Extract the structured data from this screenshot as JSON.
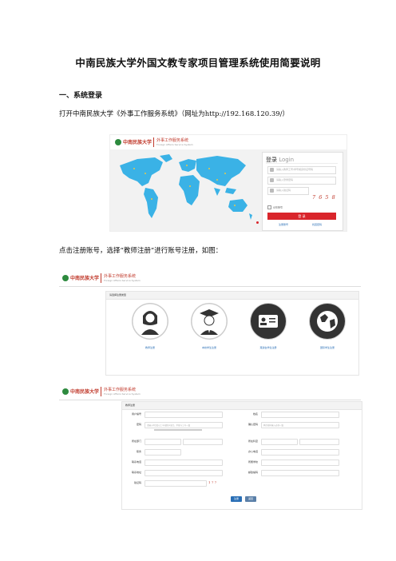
{
  "doc": {
    "title": "中南民族大学外国文教专家项目管理系统使用简要说明",
    "section1": "一、系统登录",
    "para1": "打开中南民族大学《外事工作服务系统》（网址为http://192.168.120.39/）",
    "para2": "点击注册账号，选择“教师注册”进行账号注册，如图："
  },
  "login_shot": {
    "logo_name": "中南民族大学",
    "system_name": "外事工作服务系统",
    "system_name_en": "Foreign Affairs Service System",
    "login_title": "登录",
    "login_title_en": "Login",
    "username_placeholder": "请输入教师工号/学号或身份证号码",
    "password_placeholder": "请输入登录密码",
    "captcha_placeholder": "请输入验证码",
    "captcha_text": "7 6 5 8",
    "remember_label": "记住账号",
    "login_button": "登 录",
    "register_link": "注册账号",
    "forgot_link": "找回密码"
  },
  "register_type_shot": {
    "panel_title": "请选择注册类型",
    "options": [
      {
        "label": "教师注册",
        "icon": "teacher-icon"
      },
      {
        "label": "本校学生注册",
        "icon": "graduate-icon"
      },
      {
        "label": "港澳台学生注册",
        "icon": "id-card-icon"
      },
      {
        "label": "国际学生注册",
        "icon": "globe-icon"
      }
    ]
  },
  "register_form_shot": {
    "panel_title": "教师注册",
    "fields_left": [
      "用户编号",
      "密码",
      "所在部门",
      "职务",
      "联系电话",
      "联系地址",
      "验证码"
    ],
    "fields_right": [
      "姓名",
      "确认密码",
      "所在科室",
      "办公电话",
      "所属学校",
      "邮政编码"
    ],
    "password_placeholder": "请输入6位及以上字母数字混合，不能与工号一致",
    "confirm_placeholder": "两次密码输入必须一致",
    "captcha_text": "1 7 7",
    "submit_button": "注册",
    "back_button": "返回"
  }
}
